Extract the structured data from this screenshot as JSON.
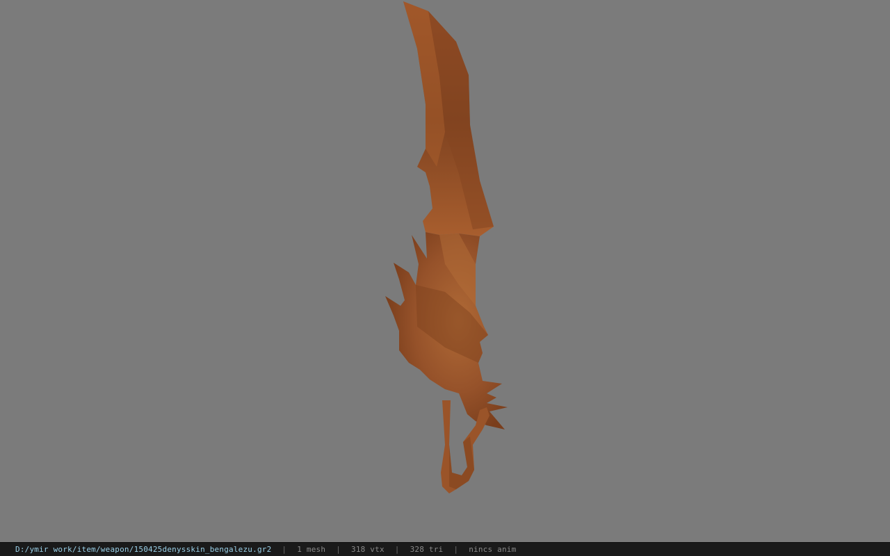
{
  "viewer": {
    "background_color": "#7b7b7b",
    "model_color": "#a05a2c",
    "model_icon": "sword-model"
  },
  "status": {
    "file_path": "D:/ymir work/item/weapon/150425denysskin_bengalezu.gr2",
    "mesh_count": "1 mesh",
    "vertex_count": "318 vtx",
    "triangle_count": "328 tri",
    "anim_status": "nincs anim",
    "separator": "|"
  }
}
